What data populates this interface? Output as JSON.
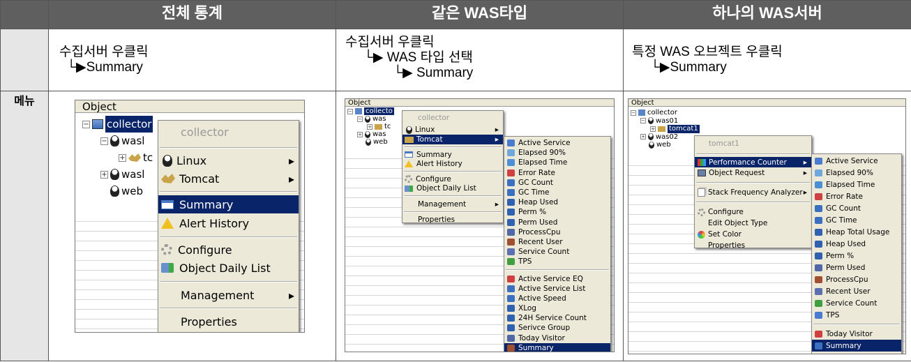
{
  "headers": [
    "전체 통계",
    "같은 WAS타입",
    "하나의 WAS서버"
  ],
  "row_label": "메뉴",
  "desc": {
    "col1": [
      "수집서버 우클릭",
      "  └▶Summary"
    ],
    "col2": [
      "수집서버 우클릭",
      "     └▶ WAS 타입 선택",
      "             └▶ Summary"
    ],
    "col3": [
      "특정 WAS 오브젝트 우클릭",
      "     └▶Summary"
    ]
  },
  "shot1": {
    "pane_title": "Object",
    "tree": {
      "collector": "collector",
      "was1": "wasl",
      "tc": "tc",
      "was2": "wasl",
      "web": "web"
    },
    "menu": {
      "title": "collector",
      "linux": "Linux",
      "tomcat": "Tomcat",
      "summary": "Summary",
      "alert_history": "Alert History",
      "configure": "Configure",
      "object_daily_list": "Object Daily List",
      "management": "Management",
      "properties": "Properties"
    }
  },
  "shot2": {
    "pane_title": "Object",
    "tree": {
      "collector": "collecto",
      "was": "was",
      "tc": "tc",
      "was2": "was",
      "web": "web"
    },
    "menu": {
      "title": "collector",
      "linux": "Linux",
      "tomcat": "Tomcat",
      "summary": "Summary",
      "alert_history": "Alert History",
      "configure": "Configure",
      "object_daily_list": "Object Daily List",
      "management": "Management",
      "properties": "Properties"
    },
    "submenu": [
      "Active Service",
      "Elapsed 90%",
      "Elapsed Time",
      "Error Rate",
      "GC Count",
      "GC Time",
      "Heap Used",
      "Perm %",
      "Perm Used",
      "ProcessCpu",
      "Recent User",
      "Service Count",
      "TPS"
    ],
    "submenu2": [
      "Active Service EQ",
      "Active Service List",
      "Active Speed",
      "XLog",
      "24H Service Count",
      "Serivce Group",
      "Today Visitor",
      "Summary"
    ]
  },
  "shot3": {
    "pane_title": "Object",
    "tree": {
      "collector": "collector",
      "was01": "was01",
      "tomcat1": "tomcat1",
      "was02": "was02",
      "web": "web"
    },
    "menu": {
      "title": "tomcat1",
      "perf_counter": "Performance Counter",
      "object_request": "Object Request",
      "stack_freq": "Stack Frequency Analyzer",
      "configure": "Configure",
      "edit_type": "Edit Object Type",
      "set_color": "Set Color",
      "properties": "Properties"
    },
    "submenu": [
      "Active Service",
      "Elapsed 90%",
      "Elapsed Time",
      "Error Rate",
      "GC Count",
      "GC Time",
      "Heap Total Usage",
      "Heap Used",
      "Perm %",
      "Perm Used",
      "ProcessCpu",
      "Recent User",
      "Service Count",
      "TPS"
    ],
    "submenu2": [
      "Today Visitor",
      "Summary"
    ]
  },
  "colors": {
    "header_bg": "#5f5f5f",
    "row_label_bg": "#e6e6e6",
    "selection": "#0a246a",
    "menu_bg": "#ece9d8"
  }
}
